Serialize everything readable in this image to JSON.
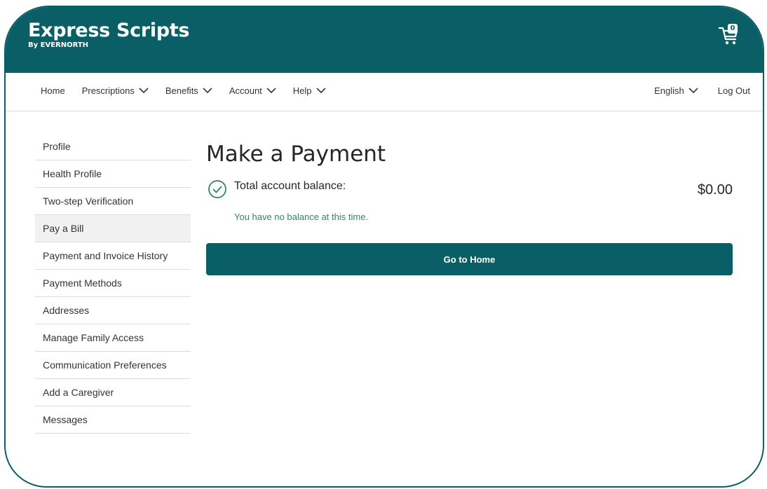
{
  "brand": {
    "name": "Express Scripts",
    "sub": "By EVERNORTH"
  },
  "cart": {
    "count": "0"
  },
  "nav": {
    "left": [
      {
        "label": "Home",
        "dropdown": false
      },
      {
        "label": "Prescriptions",
        "dropdown": true
      },
      {
        "label": "Benefits",
        "dropdown": true
      },
      {
        "label": "Account",
        "dropdown": true
      },
      {
        "label": "Help",
        "dropdown": true
      }
    ],
    "language": "English",
    "logout": "Log Out"
  },
  "sidebar": {
    "items": [
      {
        "label": "Profile"
      },
      {
        "label": "Health Profile"
      },
      {
        "label": "Two-step Verification"
      },
      {
        "label": "Pay a Bill",
        "active": true
      },
      {
        "label": "Payment and Invoice History"
      },
      {
        "label": "Payment Methods"
      },
      {
        "label": "Addresses"
      },
      {
        "label": "Manage Family Access"
      },
      {
        "label": "Communication Preferences"
      },
      {
        "label": "Add a Caregiver"
      },
      {
        "label": "Messages"
      }
    ]
  },
  "main": {
    "title": "Make a Payment",
    "balance_label": "Total account balance:",
    "balance_amount": "$0.00",
    "no_balance_text": "You have no balance at this time.",
    "button_label": "Go to Home"
  },
  "colors": {
    "brand": "#0a5f66",
    "success": "#2e8b57"
  },
  "icons": {
    "cart": "shopping-cart-icon",
    "chevron": "chevron-down-icon",
    "check": "check-circle-icon"
  }
}
